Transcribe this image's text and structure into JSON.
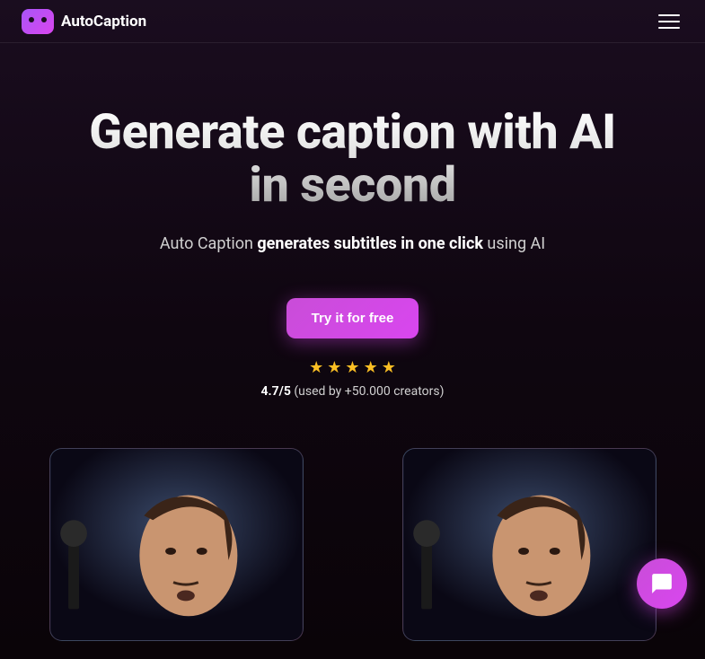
{
  "header": {
    "logo_text": "AutoCaption"
  },
  "hero": {
    "title_line1": "Generate caption with AI",
    "title_line2": "in second",
    "subtitle_prefix": "Auto Caption ",
    "subtitle_bold": "generates subtitles in one click",
    "subtitle_suffix": " using AI",
    "cta_label": "Try it for free"
  },
  "rating": {
    "score": "4.7/5",
    "usage": " (used by +50.000 creators)",
    "star_count": 5
  },
  "colors": {
    "accent": "#d946ef",
    "star": "#fbbf24"
  }
}
